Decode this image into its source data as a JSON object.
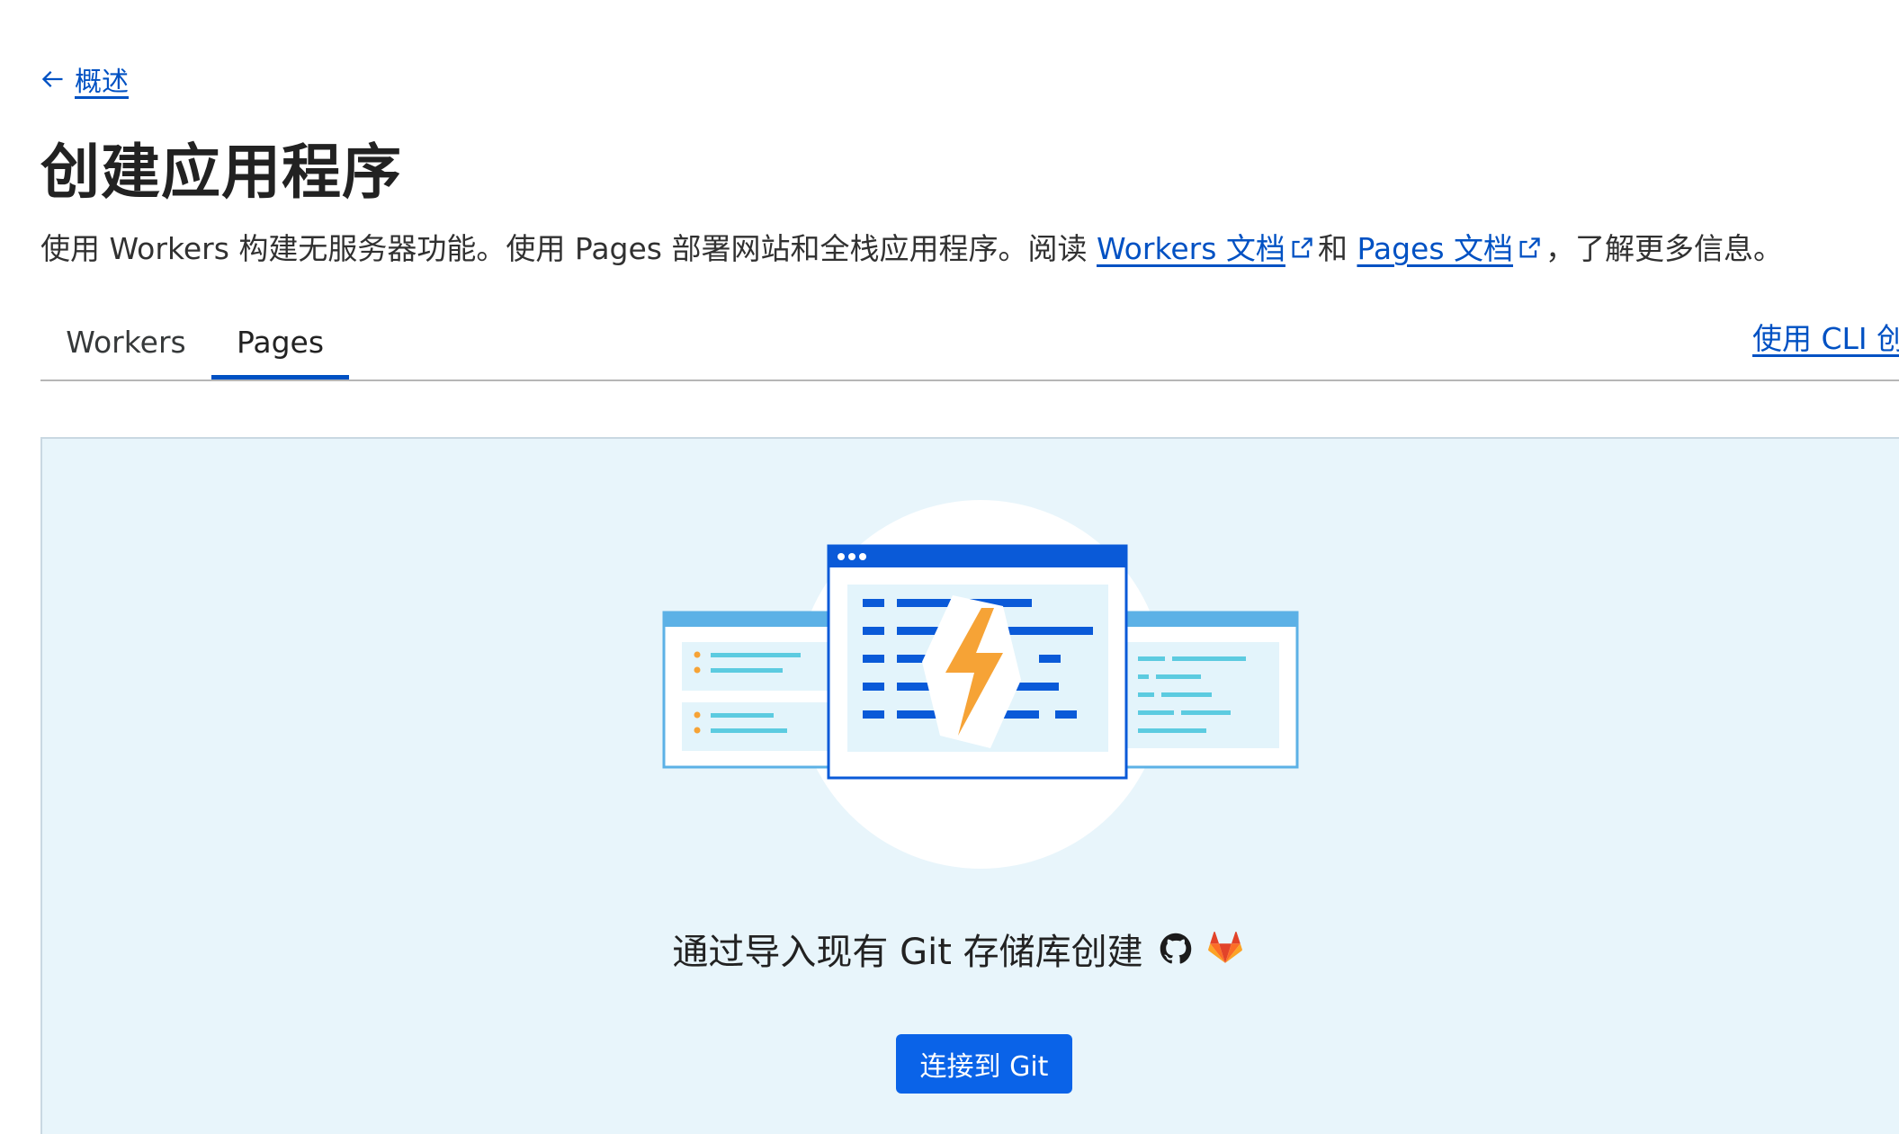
{
  "nav": {
    "back_label": "概述"
  },
  "header": {
    "title": "创建应用程序",
    "desc_part1": "使用 Workers 构建无服务器功能。使用 Pages 部署网站和全栈应用程序。阅读 ",
    "workers_docs_link": "Workers 文档",
    "desc_and": "和 ",
    "pages_docs_link": "Pages 文档",
    "desc_part2": "，了解更多信息。"
  },
  "tabs": [
    {
      "label": "Workers",
      "active": false
    },
    {
      "label": "Pages",
      "active": true
    }
  ],
  "cli_link": "使用 CLI 创建",
  "panel": {
    "heading": "通过导入现有 Git 存储库创建",
    "icons": [
      "github-icon",
      "gitlab-icon"
    ],
    "connect_button": "连接到 Git"
  },
  "colors": {
    "accent": "#0051c3",
    "button": "#0a63e8",
    "panel_bg": "#e8f5fb",
    "bolt": "#f6a336"
  }
}
